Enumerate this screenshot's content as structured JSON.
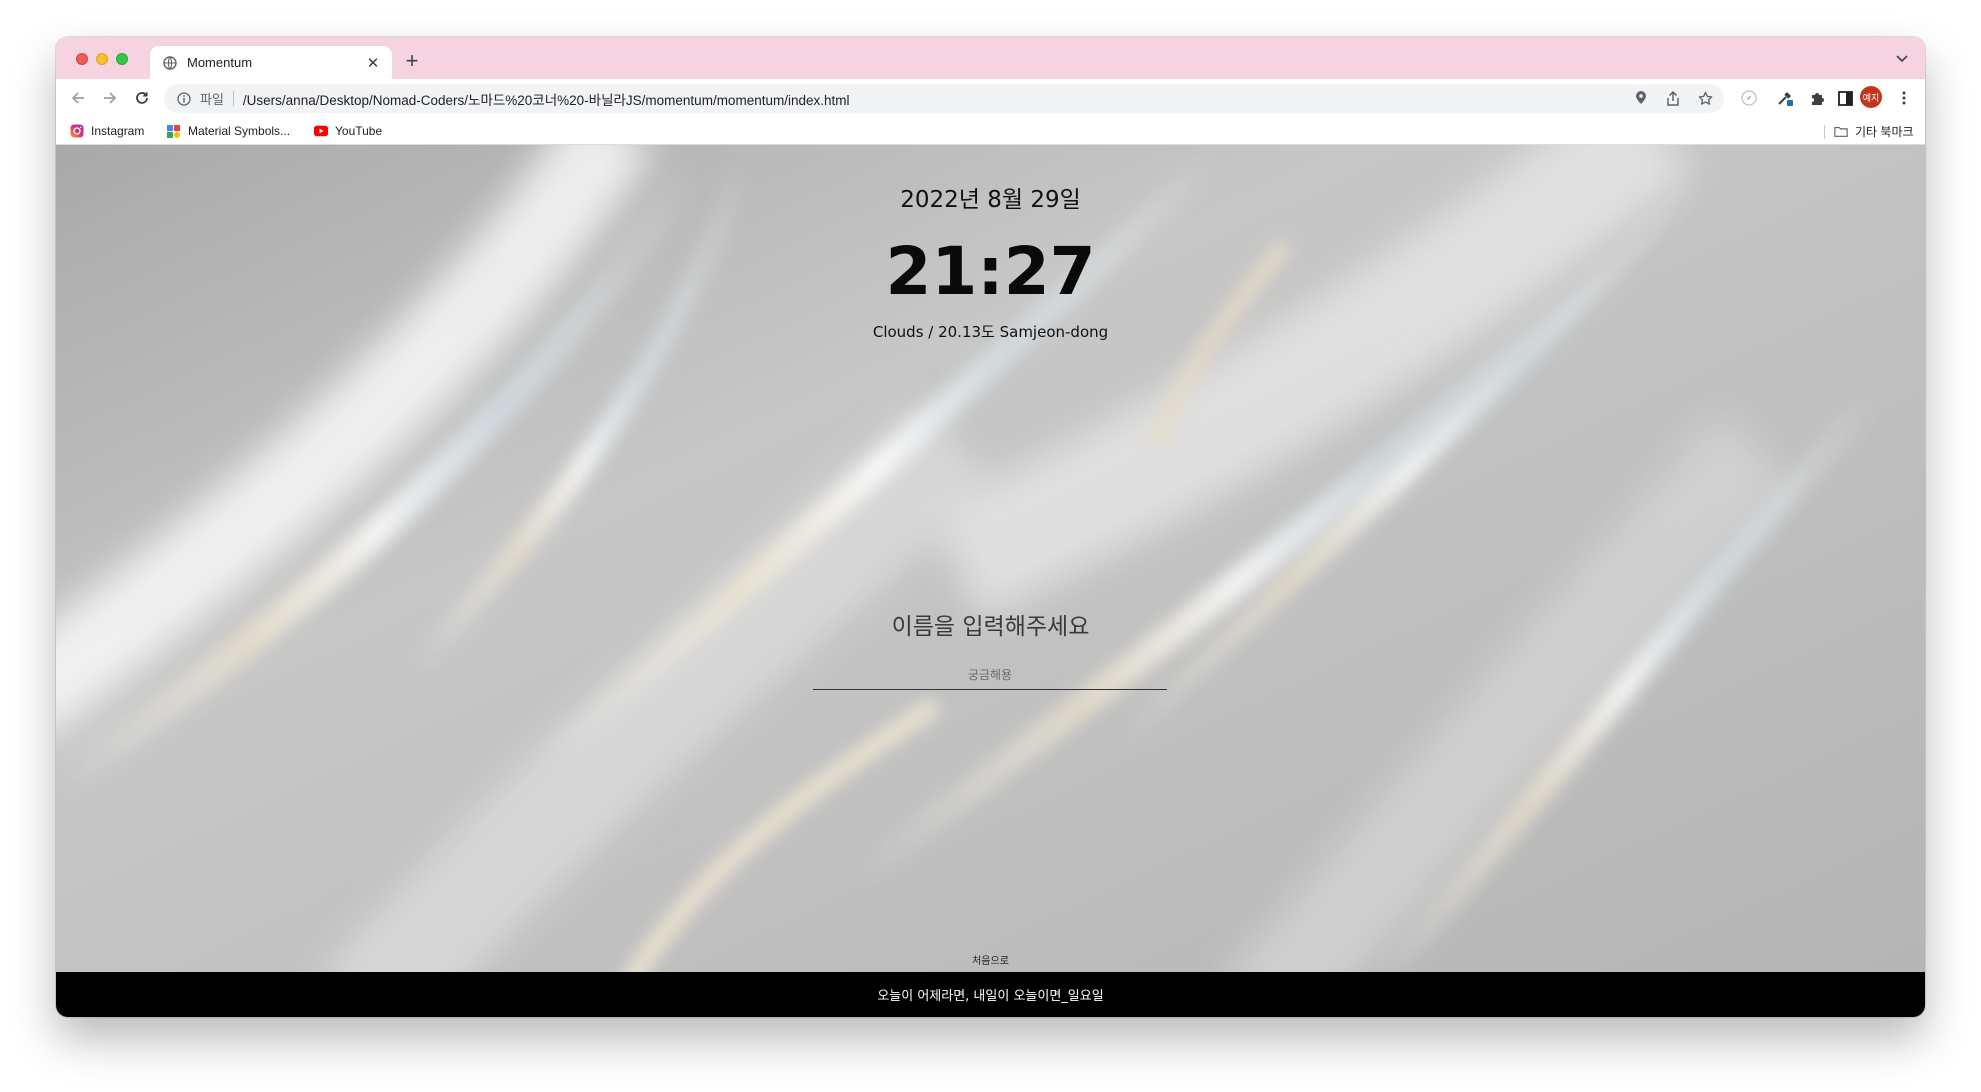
{
  "browser": {
    "tab": {
      "title": "Momentum",
      "favicon": "globe-icon"
    },
    "new_tab_label": "+",
    "address_bar": {
      "scheme_label": "파일",
      "url": "/Users/anna/Desktop/Nomad-Coders/노마드%20코너%20-바닐라JS/momentum/momentum/index.html"
    },
    "profile_initials": "예지",
    "bookmarks": [
      {
        "label": "Instagram",
        "icon": "instagram-icon"
      },
      {
        "label": "Material Symbols...",
        "icon": "material-symbols-icon"
      },
      {
        "label": "YouTube",
        "icon": "youtube-icon"
      }
    ],
    "other_bookmarks_label": "기타 북마크",
    "colors": {
      "tab_strip": "#f5d3e1",
      "profile": "#c2361f"
    }
  },
  "page": {
    "date": "2022년 8월 29일",
    "clock": "21:27",
    "weather": "Clouds / 20.13도 Samjeon-dong",
    "greeting_prompt": "이름을 입력해주세요",
    "name_input": {
      "placeholder": "궁금해용",
      "value": ""
    },
    "home_link": "처음으로",
    "quote": "오늘이 어제라면, 내일이 오늘이면_일요일"
  }
}
